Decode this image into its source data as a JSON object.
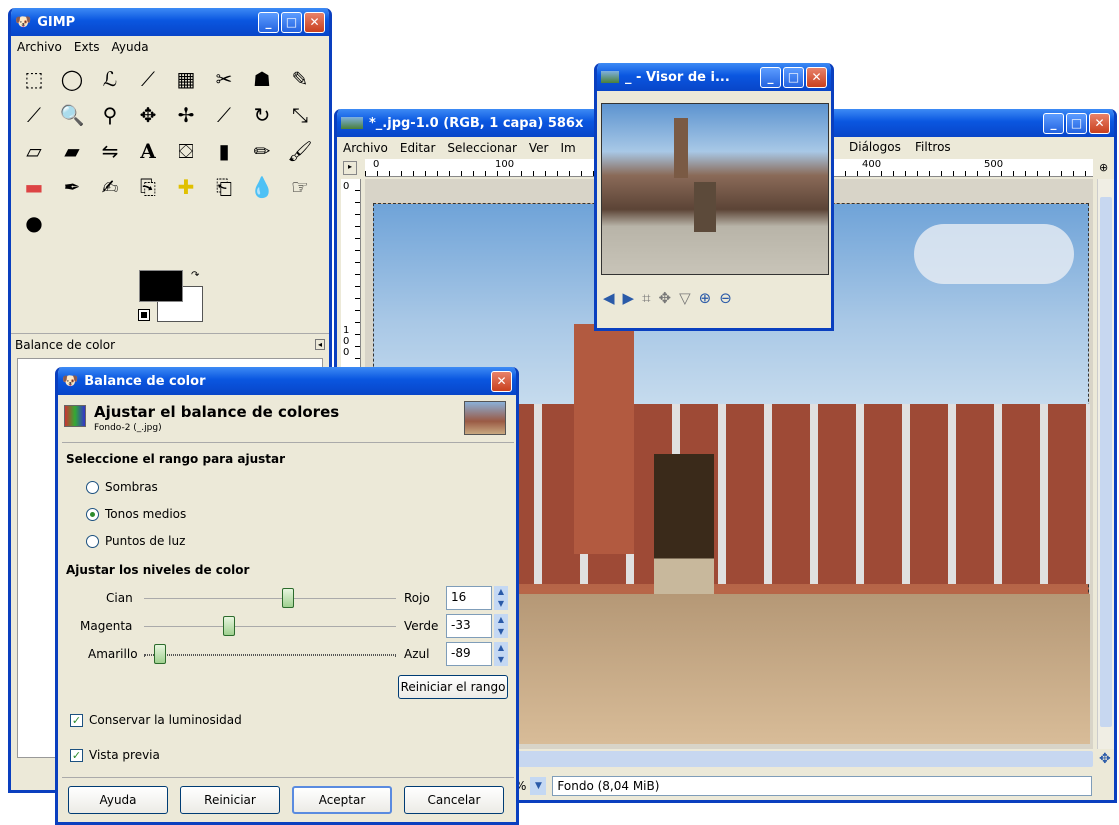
{
  "gimp_toolbox": {
    "title": "GIMP",
    "menu": [
      "Archivo",
      "Exts",
      "Ayuda"
    ],
    "dock_label": "Balance de color"
  },
  "image_window": {
    "title": "*_.jpg-1.0 (RGB, 1 capa) 586x",
    "menu": [
      "Archivo",
      "Editar",
      "Seleccionar",
      "Ver",
      "Im",
      "Diálogos",
      "Filtros"
    ],
    "ruler_top": [
      "0",
      "100",
      "400",
      "500"
    ],
    "ruler_left_top": "0",
    "ruler_left_mid": "100",
    "zoom_suffix": "%",
    "status": "Fondo (8,04 MiB)"
  },
  "navigator": {
    "title": "_ - Visor de i..."
  },
  "dialog": {
    "title": "Balance de color",
    "heading": "Ajustar el balance de colores",
    "subheading": "Fondo-2 (_.jpg)",
    "range_section": "Seleccione el rango para ajustar",
    "ranges": [
      "Sombras",
      "Tonos medios",
      "Puntos de luz"
    ],
    "selected_range": "Tonos medios",
    "levels_section": "Ajustar los niveles de color",
    "sliders": [
      {
        "left": "Cian",
        "right": "Rojo",
        "value": "16"
      },
      {
        "left": "Magenta",
        "right": "Verde",
        "value": "-33"
      },
      {
        "left": "Amarillo",
        "right": "Azul",
        "value": "-89"
      }
    ],
    "reset_range": "Reiniciar el rango",
    "preserve_lum": "Conservar la luminosidad",
    "preview": "Vista previa",
    "buttons": [
      "Ayuda",
      "Reiniciar",
      "Aceptar",
      "Cancelar"
    ]
  },
  "colors": {
    "titlebar": "#0a56e0",
    "window_bg": "#ece9d8"
  }
}
